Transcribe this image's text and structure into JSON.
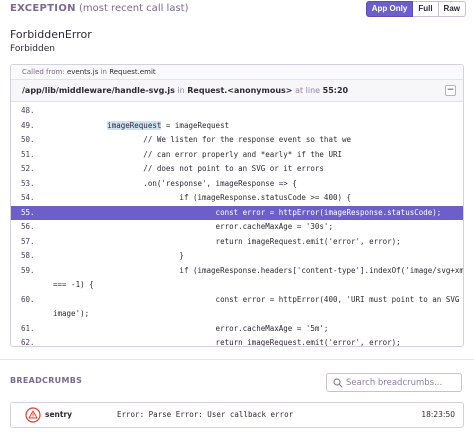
{
  "exception": {
    "label": "EXCEPTION",
    "sublabel": "(most recent call last)",
    "view_buttons": [
      "App Only",
      "Full",
      "Raw"
    ],
    "active_view": "App Only",
    "error_name": "ForbiddenError",
    "error_message": "Forbidden"
  },
  "frame": {
    "called_from_prefix": "Called from:",
    "called_from_file": "events.js",
    "called_from_in": "in",
    "called_from_function": "Request.emit",
    "path": "/app/lib/middleware/handle-svg.js",
    "in_text": "in",
    "function": "Request.<anonymous>",
    "at_line_text": "at line",
    "line_pos": "55:20",
    "collapse_symbol": "−"
  },
  "code": [
    {
      "ln": "48.",
      "src": ""
    },
    {
      "ln": "49.",
      "src": "            imageRequest = imageRequest"
    },
    {
      "ln": "50.",
      "src": "                    // We listen for the response event so that we"
    },
    {
      "ln": "51.",
      "src": "                    // can error properly and *early* if the URI"
    },
    {
      "ln": "52.",
      "src": "                    // does not point to an SVG or it errors"
    },
    {
      "ln": "53.",
      "src": "                    .on('response', imageResponse => {"
    },
    {
      "ln": "54.",
      "src": "                            if (imageResponse.statusCode >= 400) {"
    },
    {
      "ln": "55.",
      "src": "                                    const error = httpError(imageResponse.statusCode);"
    },
    {
      "ln": "56.",
      "src": "                                    error.cacheMaxAge = '30s';"
    },
    {
      "ln": "57.",
      "src": "                                    return imageRequest.emit('error', error);"
    },
    {
      "ln": "58.",
      "src": "                            }"
    },
    {
      "ln": "59.",
      "src": "                            if (imageResponse.headers['content-type'].indexOf('image/svg+xml')"
    },
    {
      "ln": "",
      "src": "=== -1) {"
    },
    {
      "ln": "60.",
      "src": "                                    const error = httpError(400, 'URI must point to an SVG"
    },
    {
      "ln": "",
      "src": "image');"
    },
    {
      "ln": "61.",
      "src": "                                    error.cacheMaxAge = '5m';"
    },
    {
      "ln": "62.",
      "src": "                                    return imageRequest.emit('error', error);"
    }
  ],
  "active_line": "55.",
  "breadcrumbs": {
    "title": "BREADCRUMBS",
    "search_placeholder": "Search breadcrumbs...",
    "items": [
      {
        "category": "sentry",
        "message": "Error: Parse Error: User callback error",
        "time": "18:23:50",
        "level_color": "#e03e2f"
      }
    ]
  },
  "colors": {
    "accent": "#6c5fc7",
    "error": "#e03e2f"
  }
}
